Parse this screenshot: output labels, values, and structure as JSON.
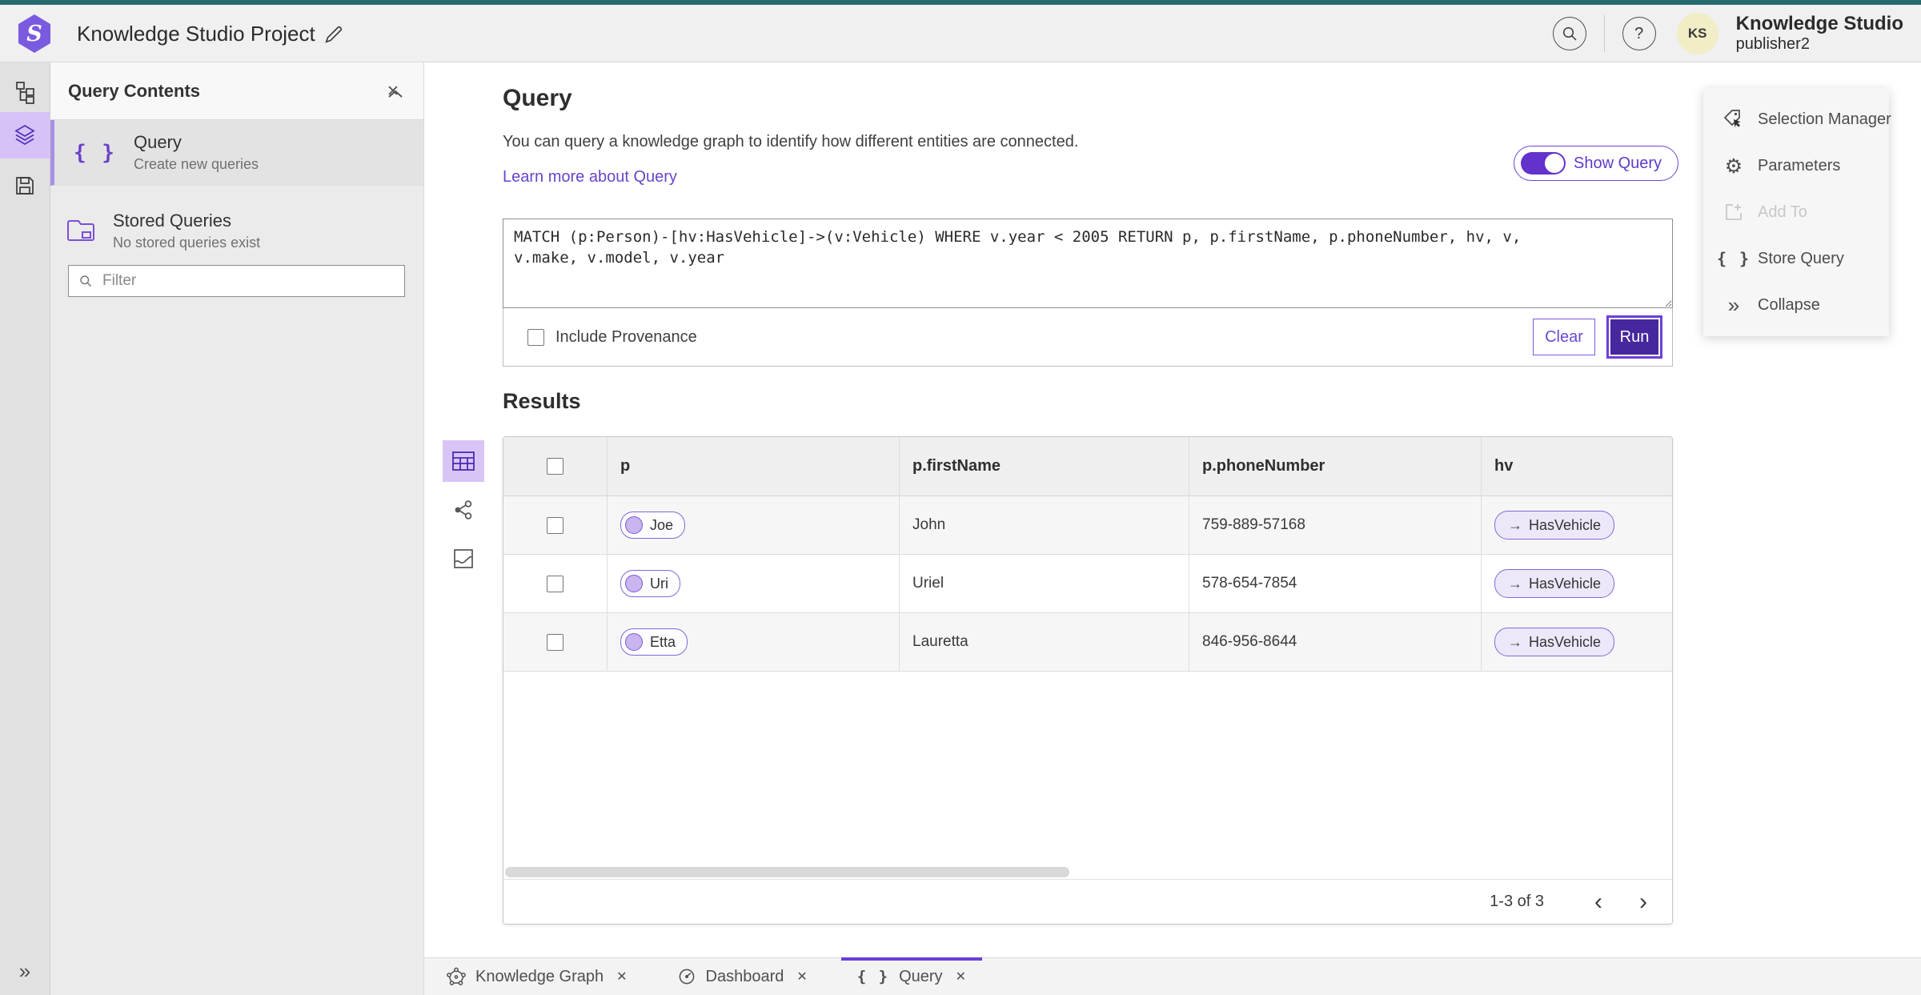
{
  "colors": {
    "accent_purple": "#5f3ac9",
    "run_button_fill": "#46279e",
    "toggle_on": "#6331cc",
    "selected_rail_bg": "#d6c2f6",
    "chip_border": "#8468d9",
    "chip_circle_fill": "#c9b5ef",
    "top_strip_teal": "#26696e",
    "avatar_bg": "#f1edc6"
  },
  "header": {
    "project_title": "Knowledge Studio Project",
    "account_name": "Knowledge Studio",
    "account_role": "publisher2",
    "avatar_initials": "KS",
    "help_glyph": "?"
  },
  "icons": {
    "braces": "{ }",
    "close": "✕",
    "edge_arrow": "→",
    "collapse_chevrons": "»",
    "expand_chevrons": "»",
    "gear": "⚙",
    "chevron_left": "‹",
    "chevron_right": "›"
  },
  "left_panel": {
    "title": "Query Contents",
    "query_item": {
      "label": "Query",
      "description": "Create new queries"
    },
    "stored_queries": {
      "label": "Stored Queries",
      "description": "No stored queries exist"
    },
    "filter_placeholder": "Filter"
  },
  "query_panel": {
    "title": "Query",
    "description": "You can query a knowledge graph to identify how different entities are connected.",
    "learn_more_link": "Learn more about Query",
    "show_query_label": "Show Query",
    "query_text": "MATCH (p:Person)-[hv:HasVehicle]->(v:Vehicle) WHERE v.year < 2005 RETURN p, p.firstName, p.phoneNumber, hv, v,\nv.make, v.model, v.year",
    "include_provenance": "Include Provenance",
    "clear_button": "Clear",
    "run_button": "Run"
  },
  "side_menu": {
    "items": [
      {
        "label": "Selection Manager",
        "disabled": false
      },
      {
        "label": "Parameters",
        "disabled": false
      },
      {
        "label": "Add To",
        "disabled": true
      },
      {
        "label": "Store Query",
        "disabled": false
      },
      {
        "label": "Collapse",
        "disabled": false
      }
    ]
  },
  "results": {
    "title": "Results",
    "columns": [
      "p",
      "p.firstName",
      "p.phoneNumber",
      "hv"
    ],
    "rows": [
      {
        "p": "Joe",
        "firstName": "John",
        "phoneNumber": "759-889-57168",
        "hv": "HasVehicle"
      },
      {
        "p": "Uri",
        "firstName": "Uriel",
        "phoneNumber": "578-654-7854",
        "hv": "HasVehicle"
      },
      {
        "p": "Etta",
        "firstName": "Lauretta",
        "phoneNumber": "846-956-8644",
        "hv": "HasVehicle"
      }
    ],
    "pagination": "1-3 of 3"
  },
  "tabs": {
    "items": [
      {
        "label": "Knowledge Graph",
        "active": false
      },
      {
        "label": "Dashboard",
        "active": false
      },
      {
        "label": "Query",
        "active": true
      }
    ]
  }
}
